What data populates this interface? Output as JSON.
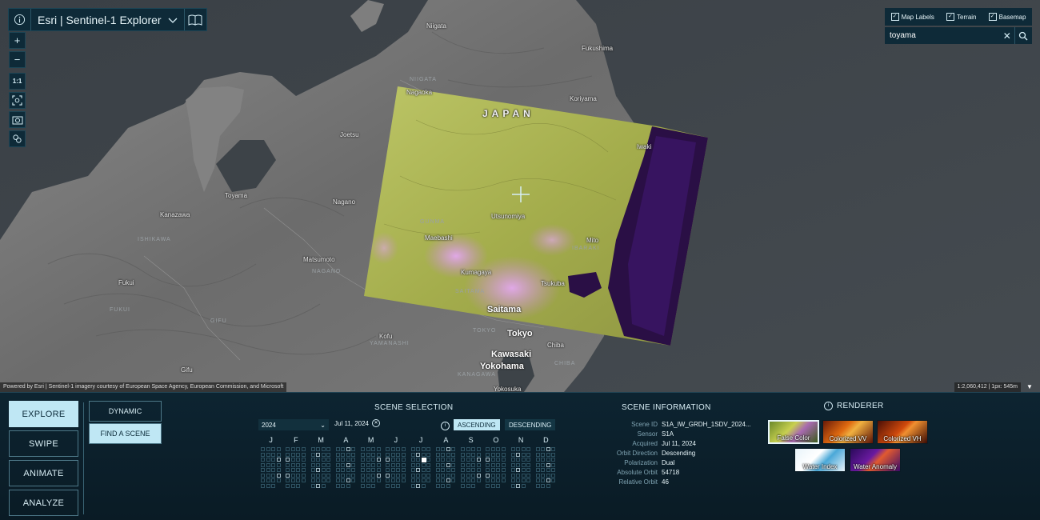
{
  "app": {
    "title": "Esri | Sentinel-1 Explorer"
  },
  "icons": {
    "info": "info-icon",
    "chevron": "chevron-down-icon",
    "book": "book-icon",
    "zoom_in": "plus-icon",
    "zoom_out": "minus-icon",
    "search": "search-icon",
    "clear": "close-icon"
  },
  "map_tools": {
    "zoom_in": "+",
    "zoom_out": "−",
    "one_to_one": "1:1"
  },
  "layer_toggles": [
    {
      "label": "Map Labels",
      "checked": true
    },
    {
      "label": "Terrain",
      "checked": true
    },
    {
      "label": "Basemap",
      "checked": true
    }
  ],
  "search": {
    "value": "toyama"
  },
  "map_labels": {
    "niigata": "Niigata",
    "fukushima": "Fukushima",
    "niigata_pref": "NIIGATA",
    "nagaoka": "Nagaoka",
    "japan": "JAPAN",
    "koriyama": "Koriyama",
    "joetsu": "Joetsu",
    "iwaki": "Iwaki",
    "toyama": "Toyama",
    "nagano": "Nagano",
    "kanazawa": "Kanazawa",
    "utsunomiya": "Utsunomiya",
    "gunma": "GUNMA",
    "ishikawa": "ISHIKAWA",
    "maebashi": "Maebashi",
    "mito": "Mito",
    "ibaraki": "IBARAKI",
    "matsumoto": "Matsumoto",
    "nagano_pref": "NAGANO",
    "kumagaya": "Kumagaya",
    "fukui": "Fukui",
    "tsukuba": "Tsukuba",
    "saitama_pref": "SAITAMA",
    "saitama": "Saitama",
    "fukui_pref": "FUKUI",
    "gifu_pref": "GIFU",
    "tokyo_pref": "TOKYO",
    "tokyo": "Tokyo",
    "kofu": "Kofu",
    "yamanashi": "YAMANASHI",
    "chiba": "Chiba",
    "kawasaki": "Kawasaki",
    "chiba_pref": "CHIBA",
    "yokohama": "Yokohama",
    "gifu": "Gifu",
    "kanagawa": "KANAGAWA",
    "yokosuka": "Yokosuka"
  },
  "attribution": "Powered by Esri | Sentinel-1 imagery courtesy of European Space Agency, European Commission, and Microsoft",
  "scale_text": "1:2,060,412 | 1px: 545m",
  "modes": [
    {
      "label": "EXPLORE",
      "active": true
    },
    {
      "label": "SWIPE",
      "active": false
    },
    {
      "label": "ANIMATE",
      "active": false
    },
    {
      "label": "ANALYZE",
      "active": false
    }
  ],
  "submodes": [
    {
      "label": "DYNAMIC",
      "active": false
    },
    {
      "label": "FIND A SCENE",
      "active": true
    }
  ],
  "scene_selection": {
    "title": "SCENE SELECTION",
    "year": "2024",
    "date": "Jul 11, 2024",
    "ascending": "ASCENDING",
    "descending": "DESCENDING",
    "months": [
      "J",
      "F",
      "M",
      "A",
      "M",
      "J",
      "J",
      "A",
      "S",
      "O",
      "N",
      "D"
    ],
    "selected_month": 7,
    "selected_day": 11
  },
  "scene_info": {
    "title": "SCENE INFORMATION",
    "rows": [
      {
        "label": "Scene ID",
        "value": "S1A_IW_GRDH_1SDV_2024..."
      },
      {
        "label": "Sensor",
        "value": "S1A"
      },
      {
        "label": "Acquired",
        "value": "Jul 11, 2024"
      },
      {
        "label": "Orbit Direction",
        "value": "Descending"
      },
      {
        "label": "Polarization",
        "value": "Dual"
      },
      {
        "label": "Absolute Orbit",
        "value": "54718"
      },
      {
        "label": "Relative Orbit",
        "value": "46"
      }
    ]
  },
  "renderer": {
    "title": "RENDERER",
    "options": [
      {
        "label": "False Color",
        "active": true
      },
      {
        "label": "Colorized VV",
        "active": false
      },
      {
        "label": "Colorized VH",
        "active": false
      },
      {
        "label": "Water Index",
        "active": false
      },
      {
        "label": "Water Anomaly",
        "active": false
      }
    ]
  },
  "colors": {
    "panel_bg": "#0b1c28",
    "accent": "#bfe7f4",
    "false_color": "#b8c35a",
    "water_purple": "#3a1260"
  }
}
